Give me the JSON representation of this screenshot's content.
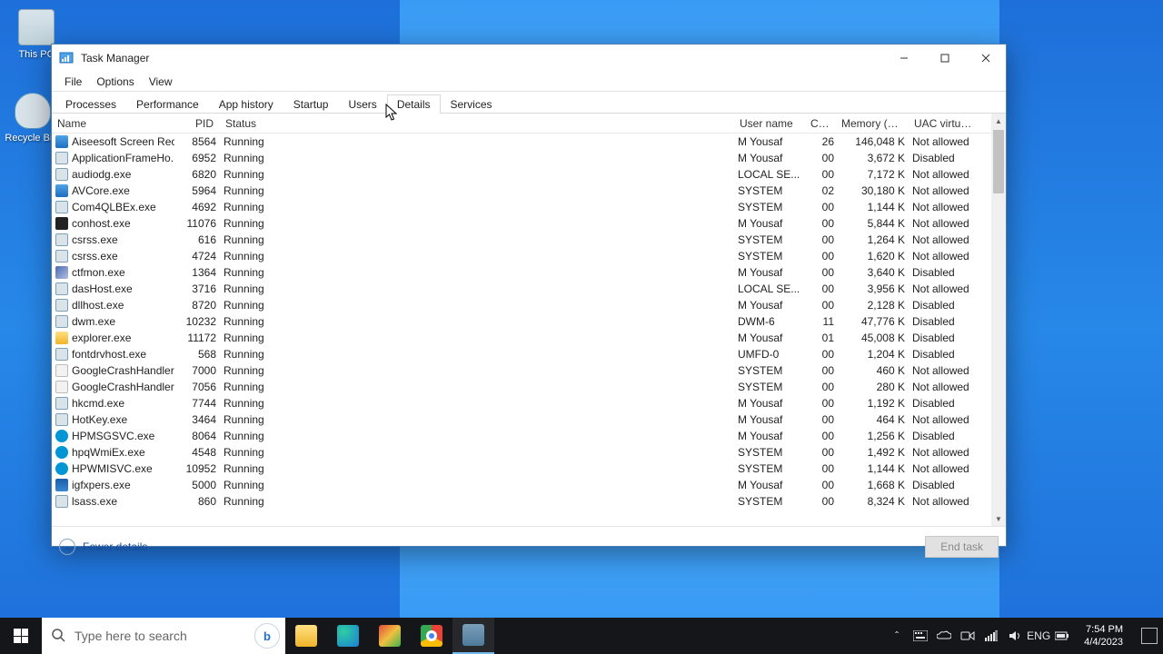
{
  "desktop": {
    "this_pc": "This PC",
    "recycle": "Recycle Bi..."
  },
  "window": {
    "title": "Task Manager",
    "menu": {
      "file": "File",
      "options": "Options",
      "view": "View"
    },
    "tabs": {
      "processes": "Processes",
      "performance": "Performance",
      "app_history": "App history",
      "startup": "Startup",
      "users": "Users",
      "details": "Details",
      "services": "Services"
    },
    "columns": {
      "name": "Name",
      "pid": "PID",
      "status": "Status",
      "user": "User name",
      "cpu": "CPU",
      "mem": "Memory (a...",
      "uac": "UAC virtualizat..."
    },
    "rows": [
      {
        "ico": "ico-blue",
        "name": "Aiseesoft Screen Rec...",
        "pid": "8564",
        "status": "Running",
        "user": "M Yousaf",
        "cpu": "26",
        "mem": "146,048 K",
        "uac": "Not allowed"
      },
      {
        "ico": "ico-exe",
        "name": "ApplicationFrameHo...",
        "pid": "6952",
        "status": "Running",
        "user": "M Yousaf",
        "cpu": "00",
        "mem": "3,672 K",
        "uac": "Disabled"
      },
      {
        "ico": "ico-exe",
        "name": "audiodg.exe",
        "pid": "6820",
        "status": "Running",
        "user": "LOCAL SE...",
        "cpu": "00",
        "mem": "7,172 K",
        "uac": "Not allowed"
      },
      {
        "ico": "ico-blue",
        "name": "AVCore.exe",
        "pid": "5964",
        "status": "Running",
        "user": "SYSTEM",
        "cpu": "02",
        "mem": "30,180 K",
        "uac": "Not allowed"
      },
      {
        "ico": "ico-exe",
        "name": "Com4QLBEx.exe",
        "pid": "4692",
        "status": "Running",
        "user": "SYSTEM",
        "cpu": "00",
        "mem": "1,144 K",
        "uac": "Not allowed"
      },
      {
        "ico": "ico-black",
        "name": "conhost.exe",
        "pid": "11076",
        "status": "Running",
        "user": "M Yousaf",
        "cpu": "00",
        "mem": "5,844 K",
        "uac": "Not allowed"
      },
      {
        "ico": "ico-exe",
        "name": "csrss.exe",
        "pid": "616",
        "status": "Running",
        "user": "SYSTEM",
        "cpu": "00",
        "mem": "1,264 K",
        "uac": "Not allowed"
      },
      {
        "ico": "ico-exe",
        "name": "csrss.exe",
        "pid": "4724",
        "status": "Running",
        "user": "SYSTEM",
        "cpu": "00",
        "mem": "1,620 K",
        "uac": "Not allowed"
      },
      {
        "ico": "ico-pen",
        "name": "ctfmon.exe",
        "pid": "1364",
        "status": "Running",
        "user": "M Yousaf",
        "cpu": "00",
        "mem": "3,640 K",
        "uac": "Disabled"
      },
      {
        "ico": "ico-exe",
        "name": "dasHost.exe",
        "pid": "3716",
        "status": "Running",
        "user": "LOCAL SE...",
        "cpu": "00",
        "mem": "3,956 K",
        "uac": "Not allowed"
      },
      {
        "ico": "ico-exe",
        "name": "dllhost.exe",
        "pid": "8720",
        "status": "Running",
        "user": "M Yousaf",
        "cpu": "00",
        "mem": "2,128 K",
        "uac": "Disabled"
      },
      {
        "ico": "ico-exe",
        "name": "dwm.exe",
        "pid": "10232",
        "status": "Running",
        "user": "DWM-6",
        "cpu": "11",
        "mem": "47,776 K",
        "uac": "Disabled"
      },
      {
        "ico": "ico-yellow",
        "name": "explorer.exe",
        "pid": "11172",
        "status": "Running",
        "user": "M Yousaf",
        "cpu": "01",
        "mem": "45,008 K",
        "uac": "Disabled"
      },
      {
        "ico": "ico-exe",
        "name": "fontdrvhost.exe",
        "pid": "568",
        "status": "Running",
        "user": "UMFD-0",
        "cpu": "00",
        "mem": "1,204 K",
        "uac": "Disabled"
      },
      {
        "ico": "ico-white",
        "name": "GoogleCrashHandler...",
        "pid": "7000",
        "status": "Running",
        "user": "SYSTEM",
        "cpu": "00",
        "mem": "460 K",
        "uac": "Not allowed"
      },
      {
        "ico": "ico-white",
        "name": "GoogleCrashHandler...",
        "pid": "7056",
        "status": "Running",
        "user": "SYSTEM",
        "cpu": "00",
        "mem": "280 K",
        "uac": "Not allowed"
      },
      {
        "ico": "ico-exe",
        "name": "hkcmd.exe",
        "pid": "7744",
        "status": "Running",
        "user": "M Yousaf",
        "cpu": "00",
        "mem": "1,192 K",
        "uac": "Disabled"
      },
      {
        "ico": "ico-exe",
        "name": "HotKey.exe",
        "pid": "3464",
        "status": "Running",
        "user": "M Yousaf",
        "cpu": "00",
        "mem": "464 K",
        "uac": "Not allowed"
      },
      {
        "ico": "ico-hp",
        "name": "HPMSGSVC.exe",
        "pid": "8064",
        "status": "Running",
        "user": "M Yousaf",
        "cpu": "00",
        "mem": "1,256 K",
        "uac": "Disabled"
      },
      {
        "ico": "ico-hp",
        "name": "hpqWmiEx.exe",
        "pid": "4548",
        "status": "Running",
        "user": "SYSTEM",
        "cpu": "00",
        "mem": "1,492 K",
        "uac": "Not allowed"
      },
      {
        "ico": "ico-hp",
        "name": "HPWMISVC.exe",
        "pid": "10952",
        "status": "Running",
        "user": "SYSTEM",
        "cpu": "00",
        "mem": "1,144 K",
        "uac": "Not allowed"
      },
      {
        "ico": "ico-intel",
        "name": "igfxpers.exe",
        "pid": "5000",
        "status": "Running",
        "user": "M Yousaf",
        "cpu": "00",
        "mem": "1,668 K",
        "uac": "Disabled"
      },
      {
        "ico": "ico-exe",
        "name": "lsass.exe",
        "pid": "860",
        "status": "Running",
        "user": "SYSTEM",
        "cpu": "00",
        "mem": "8,324 K",
        "uac": "Not allowed"
      }
    ],
    "footer": {
      "fewer": "Fewer details",
      "end_task": "End task"
    }
  },
  "taskbar": {
    "search_placeholder": "Type here to search",
    "time": "7:54 PM",
    "date": "4/4/2023"
  }
}
